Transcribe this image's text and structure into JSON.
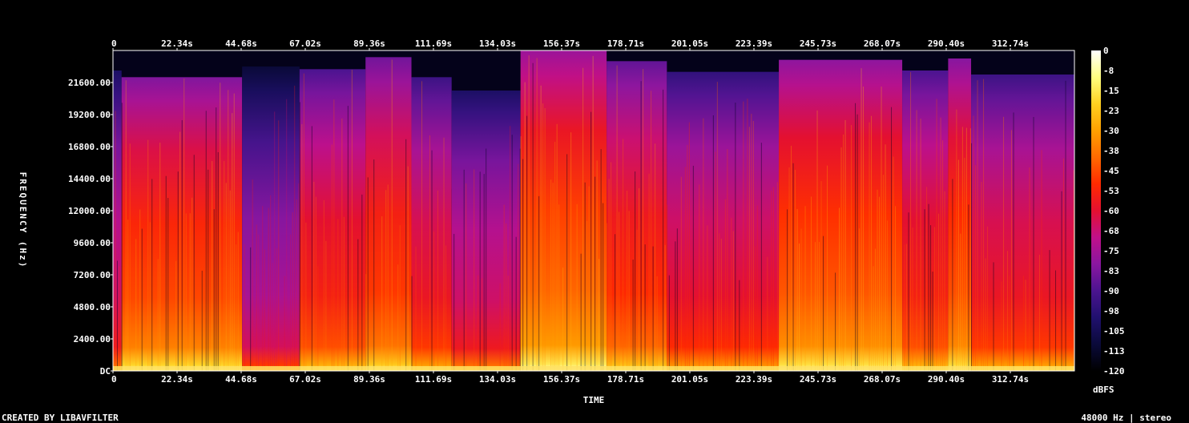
{
  "chart_data": {
    "type": "heatmap",
    "xlabel": "TIME",
    "ylabel": "FREQUENCY (Hz)",
    "x_ticks": [
      "0",
      "22.34s",
      "44.68s",
      "67.02s",
      "89.36s",
      "111.69s",
      "134.03s",
      "156.37s",
      "178.71s",
      "201.05s",
      "223.39s",
      "245.73s",
      "268.07s",
      "290.40s",
      "312.74s"
    ],
    "y_ticks": [
      "DC",
      "2400.00",
      "4800.00",
      "7200.00",
      "9600.00",
      "12000.00",
      "14400.00",
      "16800.00",
      "19200.00",
      "21600.00"
    ],
    "xlim": [
      0,
      335
    ],
    "ylim": [
      0,
      24000
    ],
    "colorbar": {
      "label": "dBFS",
      "ticks": [
        "0",
        "-8",
        "-15",
        "-23",
        "-30",
        "-38",
        "-45",
        "-53",
        "-60",
        "-68",
        "-75",
        "-83",
        "-90",
        "-98",
        "-105",
        "-113",
        "-120"
      ],
      "range": [
        -120,
        0
      ],
      "colors": [
        "#000000",
        "#0a0a3a",
        "#20106e",
        "#4b1490",
        "#8a16a0",
        "#c0108a",
        "#e41030",
        "#ff2a00",
        "#ff6a00",
        "#ffa000",
        "#ffd020",
        "#ffff80",
        "#ffffff"
      ]
    },
    "segments": [
      {
        "start": 0,
        "end": 3,
        "cutoff": 22500,
        "level": 0.45
      },
      {
        "start": 3,
        "end": 45,
        "cutoff": 22000,
        "level": 0.62
      },
      {
        "start": 45,
        "end": 65,
        "cutoff": 22800,
        "level": 0.38
      },
      {
        "start": 65,
        "end": 88,
        "cutoff": 22600,
        "level": 0.55
      },
      {
        "start": 88,
        "end": 104,
        "cutoff": 23500,
        "level": 0.6
      },
      {
        "start": 104,
        "end": 118,
        "cutoff": 22000,
        "level": 0.52
      },
      {
        "start": 118,
        "end": 142,
        "cutoff": 21000,
        "level": 0.45
      },
      {
        "start": 142,
        "end": 172,
        "cutoff": 24000,
        "level": 0.66
      },
      {
        "start": 172,
        "end": 193,
        "cutoff": 23200,
        "level": 0.58
      },
      {
        "start": 193,
        "end": 232,
        "cutoff": 22400,
        "level": 0.5
      },
      {
        "start": 232,
        "end": 275,
        "cutoff": 23300,
        "level": 0.64
      },
      {
        "start": 275,
        "end": 291,
        "cutoff": 22500,
        "level": 0.55
      },
      {
        "start": 291,
        "end": 299,
        "cutoff": 23400,
        "level": 0.63
      },
      {
        "start": 299,
        "end": 335,
        "cutoff": 22200,
        "level": 0.52
      }
    ]
  },
  "footer": {
    "left": "CREATED BY LIBAVFILTER",
    "right": "48000 Hz | stereo"
  }
}
